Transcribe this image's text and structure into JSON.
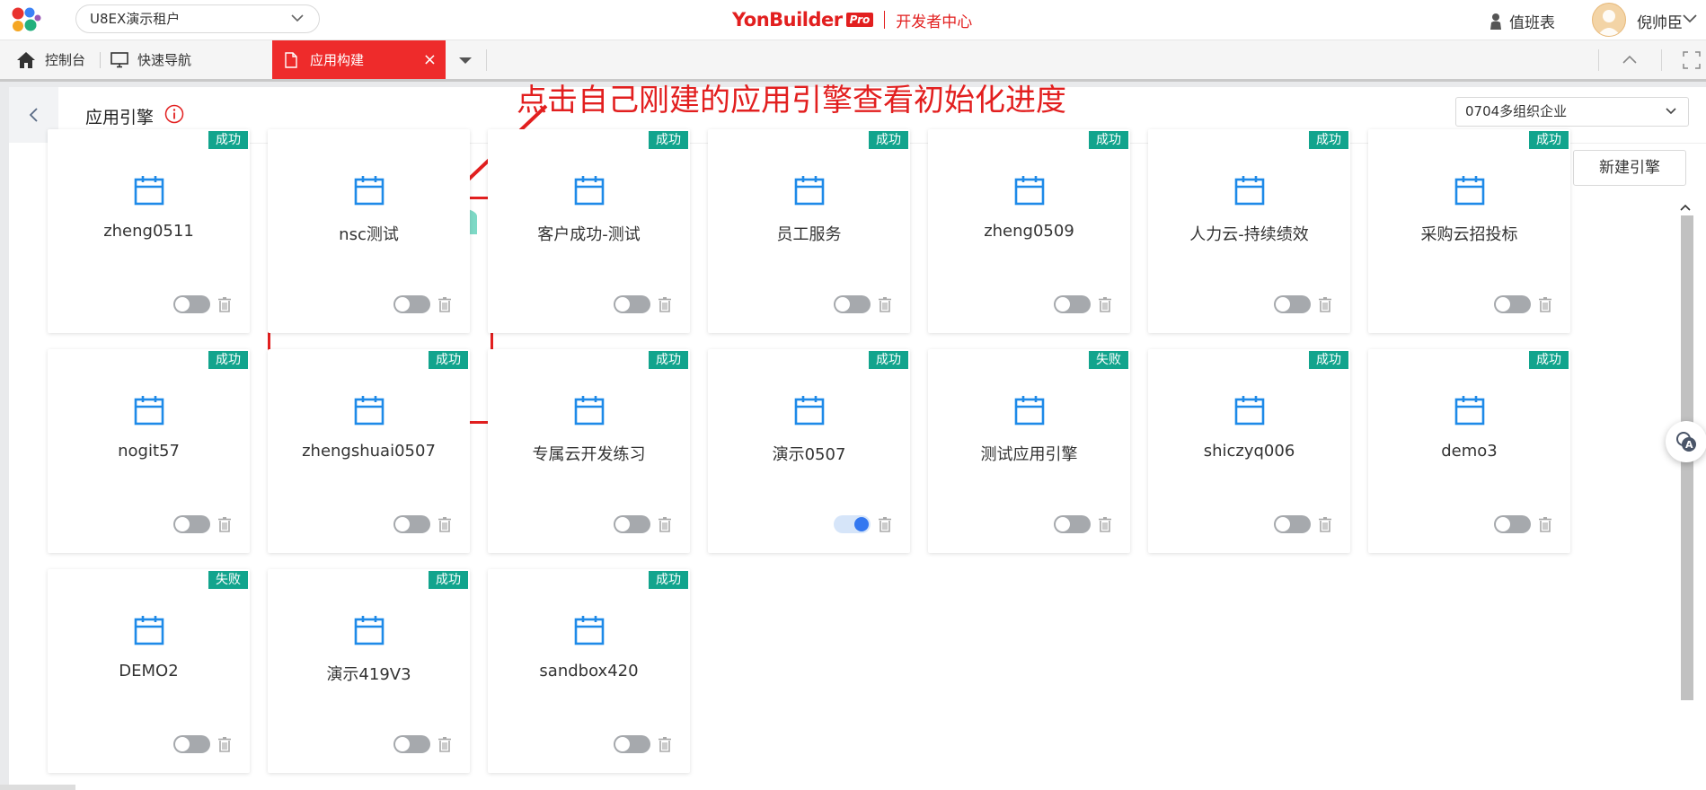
{
  "header": {
    "tenant": "U8EX演示租户",
    "brand": "YonBuilder",
    "brand_pro": "Pro",
    "brand_sub": "开发者中心",
    "duty": "值班表",
    "user": "倪帅臣"
  },
  "tabs": {
    "home": "控制台",
    "nav": "快速导航",
    "active": "应用构建",
    "close": "×"
  },
  "page": {
    "title": "应用引擎",
    "org_select": "0704多组织企业",
    "new_button": "新建引擎",
    "annotation": "点击自己刚建的应用引擎查看初始化进度"
  },
  "colors": {
    "accent_red": "#ee2b2b",
    "success_badge": "#12a48d",
    "icon_blue": "#1e8ae8",
    "toggle_on": "#3478f0"
  },
  "cards": [
    {
      "name": "zheng0511",
      "status": "成功",
      "enabled": false
    },
    {
      "name": "nsc测试",
      "status": "",
      "enabled": false
    },
    {
      "name": "客户成功-测试",
      "status": "成功",
      "enabled": false
    },
    {
      "name": "员工服务",
      "status": "成功",
      "enabled": false
    },
    {
      "name": "zheng0509",
      "status": "成功",
      "enabled": false
    },
    {
      "name": "人力云-持续绩效",
      "status": "成功",
      "enabled": false
    },
    {
      "name": "采购云招投标",
      "status": "成功",
      "enabled": false
    },
    {
      "name": "nogit57",
      "status": "成功",
      "enabled": false
    },
    {
      "name": "zhengshuai0507",
      "status": "成功",
      "enabled": false
    },
    {
      "name": "专属云开发练习",
      "status": "成功",
      "enabled": false
    },
    {
      "name": "演示0507",
      "status": "成功",
      "enabled": true
    },
    {
      "name": "测试应用引擎",
      "status": "失败",
      "enabled": false
    },
    {
      "name": "shiczyq006",
      "status": "成功",
      "enabled": false
    },
    {
      "name": "demo3",
      "status": "成功",
      "enabled": false
    },
    {
      "name": "DEMO2",
      "status": "失败",
      "enabled": false
    },
    {
      "name": "演示419V3",
      "status": "成功",
      "enabled": false
    },
    {
      "name": "sandbox420",
      "status": "成功",
      "enabled": false
    }
  ]
}
